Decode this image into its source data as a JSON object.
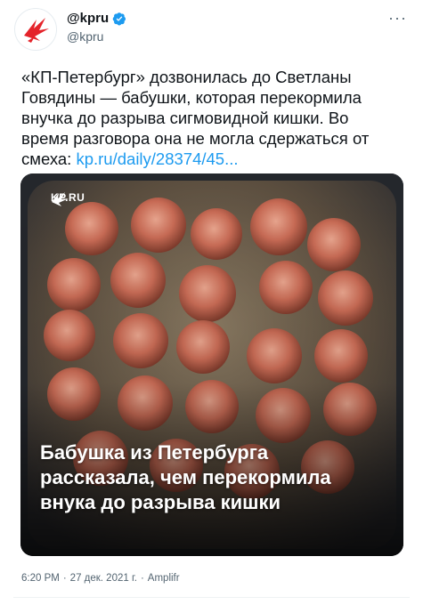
{
  "author": {
    "display_name": "@kpru",
    "handle": "@kpru",
    "verified": true,
    "verified_color": "#1d9bf0"
  },
  "more_menu": {
    "icon": "more-horizontal-icon",
    "label": "···"
  },
  "tweet": {
    "text": "«КП-Петербург» дозвонилась до Светланы\nГовядины — бабушки, которая перекормила\nвнучка до разрыва сигмовидной кишки. Во\nвремя разговора она не могла сдержаться от\nсмеха: ",
    "link": "kp.ru/daily/28374/45..."
  },
  "media": {
    "logo_text": "KP.RU",
    "headline_lines": [
      "Бабушка из Петербурга",
      "рассказала, чем перекормила",
      "внука до разрыва кишки"
    ]
  },
  "meta": {
    "time": "6:20 PM",
    "sep1": "·",
    "date": "27 дек. 2021 г.",
    "sep2": "·",
    "source": "Amplifr"
  },
  "colors": {
    "link": "#1d9bf0",
    "secondary_text": "#536471",
    "brand_red": "#e4232a"
  }
}
